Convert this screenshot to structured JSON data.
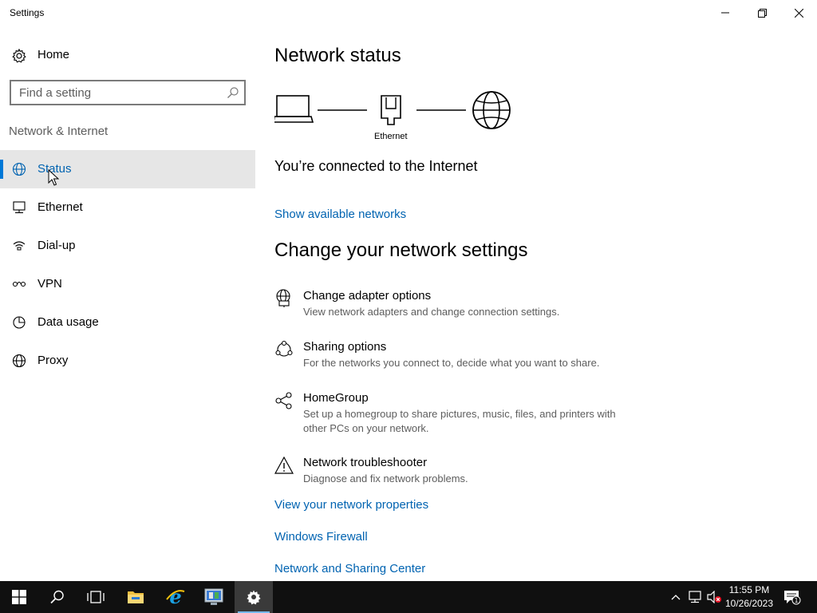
{
  "window": {
    "title": "Settings"
  },
  "sidebar": {
    "home_label": "Home",
    "search_placeholder": "Find a setting",
    "section_label": "Network & Internet",
    "items": [
      {
        "label": "Status",
        "icon": "globe-icon",
        "active": true
      },
      {
        "label": "Ethernet",
        "icon": "ethernet-icon",
        "active": false
      },
      {
        "label": "Dial-up",
        "icon": "dialup-icon",
        "active": false
      },
      {
        "label": "VPN",
        "icon": "vpn-icon",
        "active": false
      },
      {
        "label": "Data usage",
        "icon": "data-usage-icon",
        "active": false
      },
      {
        "label": "Proxy",
        "icon": "proxy-globe-icon",
        "active": false
      }
    ]
  },
  "main": {
    "title": "Network status",
    "diagram_label": "Ethernet",
    "connection_status": "You’re connected to the Internet",
    "show_networks_link": "Show available networks",
    "change_heading": "Change your network settings",
    "options": [
      {
        "title": "Change adapter options",
        "desc": "View network adapters and change connection settings.",
        "icon": "adapter-icon"
      },
      {
        "title": "Sharing options",
        "desc": "For the networks you connect to, decide what you want to share.",
        "icon": "sharing-icon"
      },
      {
        "title": "HomeGroup",
        "desc": "Set up a homegroup to share pictures, music, files, and printers with other PCs on your network.",
        "icon": "homegroup-icon"
      },
      {
        "title": "Network troubleshooter",
        "desc": "Diagnose and fix network problems.",
        "icon": "warning-icon"
      }
    ],
    "links": [
      "View your network properties",
      "Windows Firewall",
      "Network and Sharing Center"
    ]
  },
  "taskbar": {
    "time": "11:55 PM",
    "date": "10/26/2023",
    "notification_count": "1"
  },
  "colors": {
    "accent": "#0078d7",
    "link": "#0063b1",
    "taskbar": "#101010"
  }
}
